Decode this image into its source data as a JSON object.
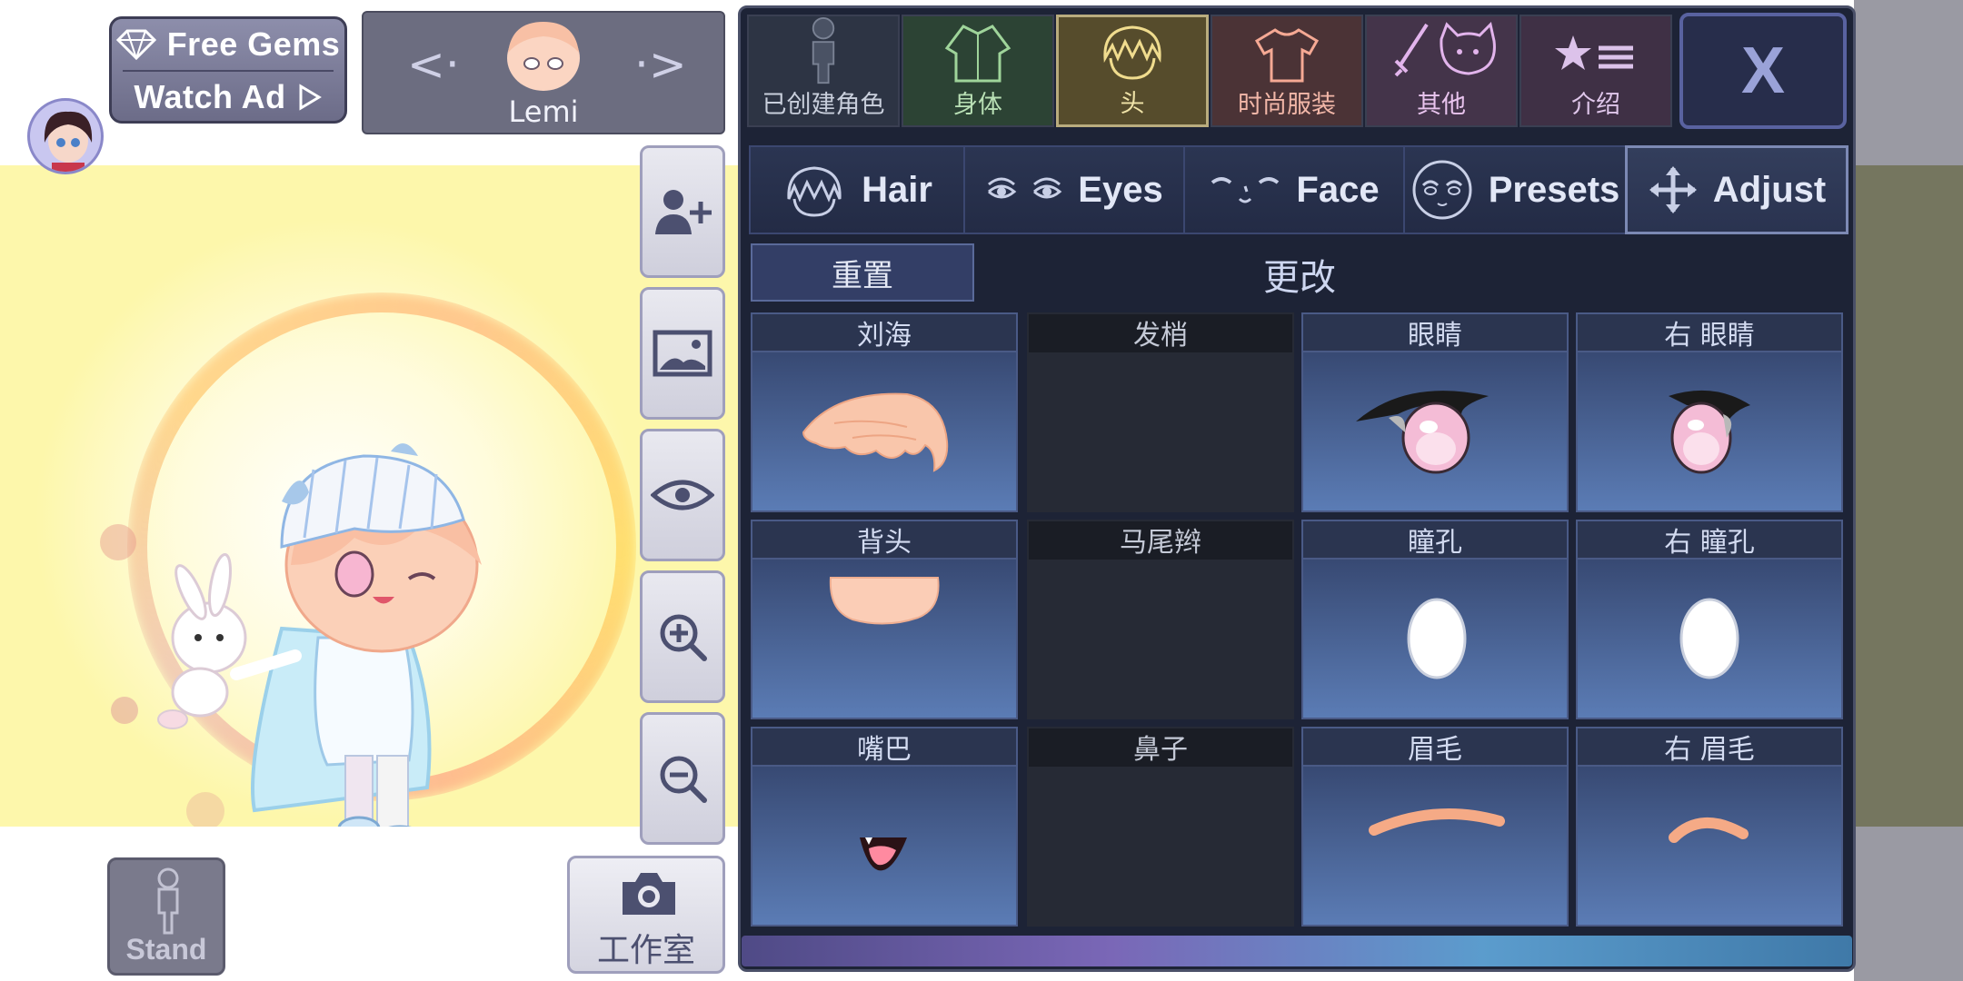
{
  "ad_widget": {
    "free_gems_label": "Free Gems",
    "watch_ad_label": "Watch Ad"
  },
  "character_selector": {
    "name": "Lemi"
  },
  "scene_tools": {
    "studio_label": "工作室",
    "stand_label": "Stand"
  },
  "categories": [
    {
      "label": "已创建角色",
      "icon": "character-silhouette-icon",
      "active": false
    },
    {
      "label": "身体",
      "icon": "body-jacket-icon",
      "active": false
    },
    {
      "label": "头",
      "icon": "head-hair-icon",
      "active": true
    },
    {
      "label": "时尚服装",
      "icon": "tshirt-icon",
      "active": false
    },
    {
      "label": "其他",
      "icon": "sword-cat-icon",
      "active": false
    },
    {
      "label": "介绍",
      "icon": "star-list-icon",
      "active": false
    }
  ],
  "close_label": "X",
  "tabs": [
    {
      "label": "Hair",
      "icon": "hair-icon"
    },
    {
      "label": "Eyes",
      "icon": "eyes-icon"
    },
    {
      "label": "Face",
      "icon": "face-icon"
    },
    {
      "label": "Presets",
      "icon": "presets-face-icon"
    },
    {
      "label": "Adjust",
      "icon": "move-arrows-icon",
      "active": true
    }
  ],
  "toolbar": {
    "reset_label": "重置",
    "change_label": "更改"
  },
  "grid": [
    {
      "label": "刘海",
      "art": "bangs",
      "empty": false
    },
    {
      "label": "发梢",
      "art": "",
      "empty": true
    },
    {
      "label": "眼睛",
      "art": "eye-left",
      "empty": false
    },
    {
      "label": "右 眼睛",
      "art": "eye-right",
      "empty": false
    },
    {
      "label": "背头",
      "art": "backhair",
      "empty": false
    },
    {
      "label": "马尾辫",
      "art": "",
      "empty": true
    },
    {
      "label": "瞳孔",
      "art": "pupil",
      "empty": false
    },
    {
      "label": "右 瞳孔",
      "art": "pupil",
      "empty": false
    },
    {
      "label": "嘴巴",
      "art": "mouth",
      "empty": false
    },
    {
      "label": "鼻子",
      "art": "",
      "empty": true
    },
    {
      "label": "眉毛",
      "art": "brow",
      "empty": false
    },
    {
      "label": "右 眉毛",
      "art": "brow",
      "empty": false
    }
  ],
  "colors": {
    "panel_bg": "#1d2336",
    "active_category": "#5a4f2a",
    "hair_peach": "#f9c6ab",
    "scene_yellow": "#fdf7ab"
  }
}
